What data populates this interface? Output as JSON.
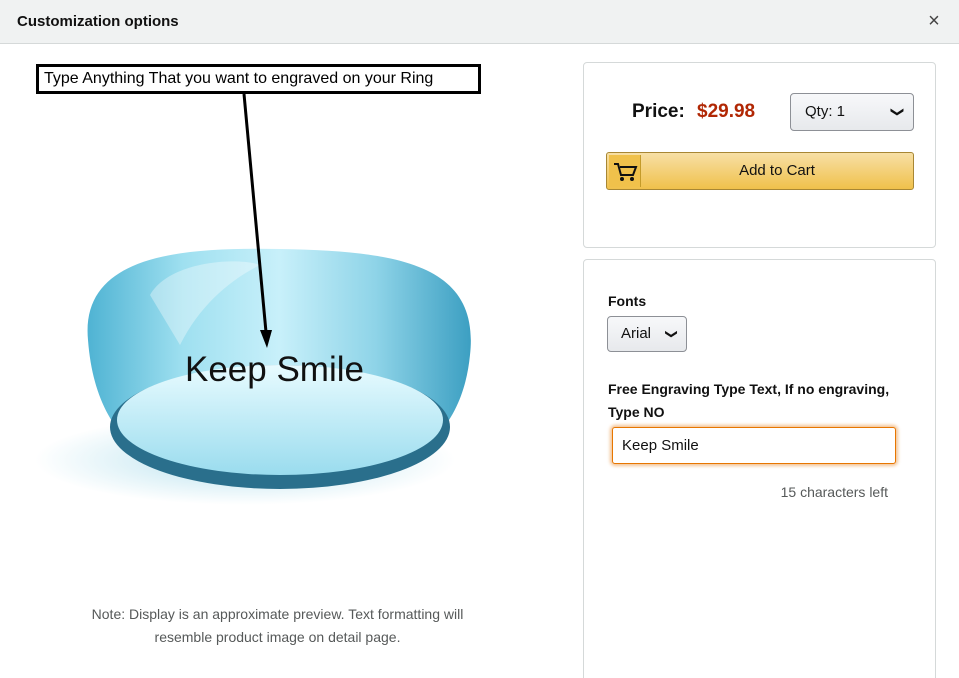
{
  "modal": {
    "title": "Customization options",
    "close_symbol": "×"
  },
  "preview": {
    "callout_text": "Type Anything That you want to engraved on your Ring",
    "engraving_text": "Keep Smile",
    "ring_color": "#8fd4e8",
    "note_line1": "Note: Display is an approximate preview. Text formatting will",
    "note_line2": "resemble product image on detail page."
  },
  "purchase": {
    "price_label": "Price:",
    "price_value": "$29.98",
    "price_color": "#b12704",
    "qty_label": "Qty: 1",
    "add_to_cart_label": "Add to Cart"
  },
  "options": {
    "fonts_label": "Fonts",
    "font_selected": "Arial",
    "engraving_label": "Free Engraving Type Text, If no engraving, Type NO",
    "engraving_value": "Keep Smile",
    "chars_left": "15 characters left"
  }
}
